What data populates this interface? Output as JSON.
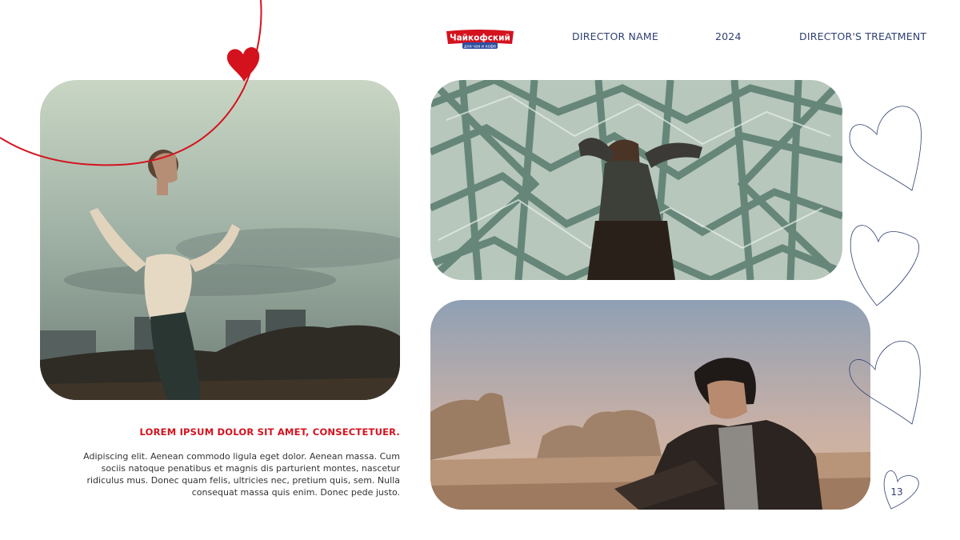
{
  "header": {
    "brand_logo": "Чайкофский",
    "brand_tagline": "для чая и кофе",
    "director": "DIRECTOR NAME",
    "year": "2024",
    "doc_title": "DIRECTOR'S TREATMENT"
  },
  "content": {
    "headline": "LOREM IPSUM DOLOR SIT AMET, CONSECTETUER.",
    "body": "Adipiscing elit. Aenean commodo ligula eget dolor. Aenean massa. Cum sociis natoque penatibus et magnis dis parturient montes, nascetur ridiculus mus. Donec quam felis, ultricies nec, pretium quis, sem. Nulla consequat massa quis enim. Donec pede justo."
  },
  "page_number": "13",
  "colors": {
    "accent_red": "#d4121e",
    "navy": "#2f3f73"
  },
  "icons": [
    "heart-icon",
    "heart-outline-icon"
  ]
}
